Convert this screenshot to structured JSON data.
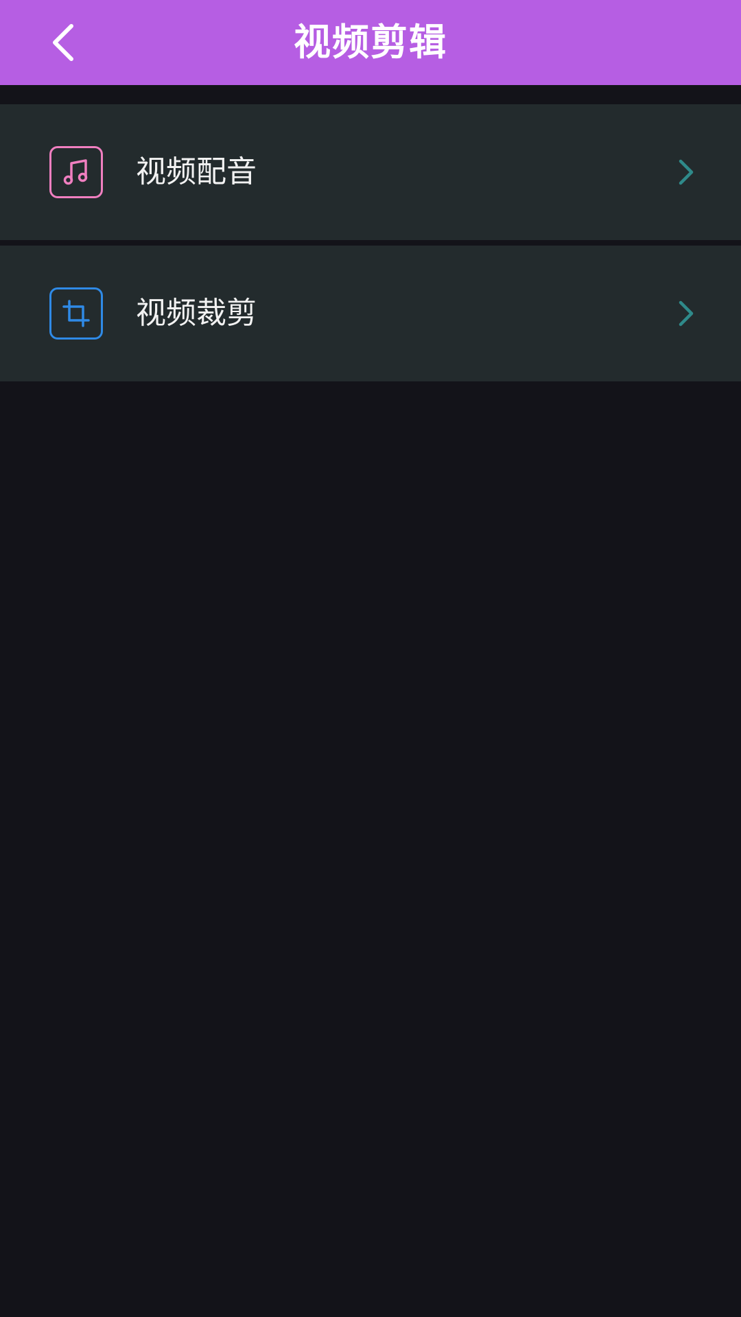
{
  "header": {
    "title": "视频剪辑",
    "back_icon": "chevron-left-icon",
    "background_color": "#b65ee3"
  },
  "menu": {
    "items": [
      {
        "label": "视频配音",
        "icon": "music-note-icon",
        "icon_color": "#f07fc0",
        "chevron_icon": "chevron-right-icon"
      },
      {
        "label": "视频裁剪",
        "icon": "crop-icon",
        "icon_color": "#2f8ae6",
        "chevron_icon": "chevron-right-icon"
      }
    ],
    "chevron_color": "#2f8a8a",
    "item_background": "#232b2d"
  },
  "colors": {
    "page_background": "#131319",
    "text": "#f2f2f2"
  }
}
